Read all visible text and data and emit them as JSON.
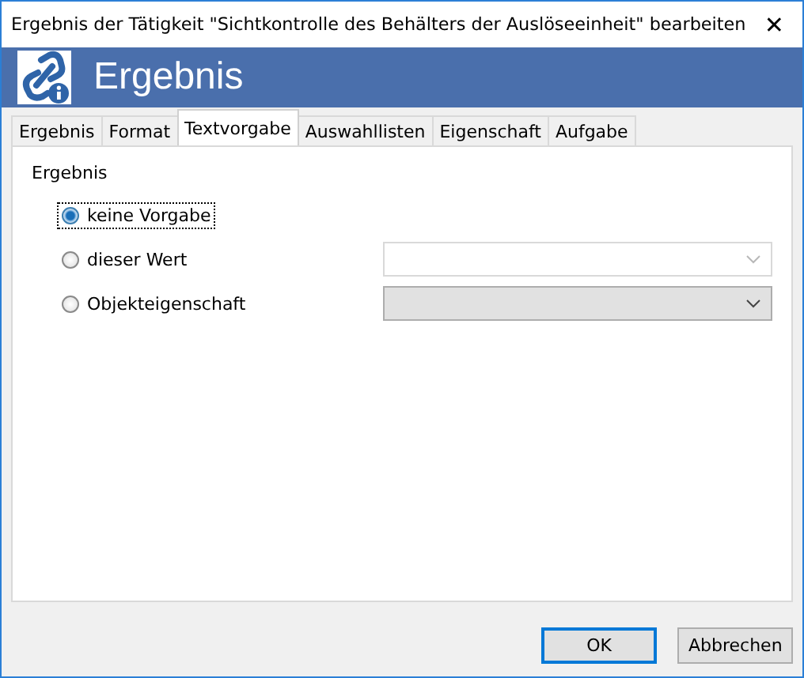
{
  "window": {
    "title": "Ergebnis der Tätigkeit \"Sichtkontrolle des Behälters der Auslöseeinheit\" bearbeiten",
    "close": "✕"
  },
  "banner": {
    "title": "Ergebnis"
  },
  "tabs": [
    {
      "label": "Ergebnis",
      "selected": false
    },
    {
      "label": "Format",
      "selected": false
    },
    {
      "label": "Textvorgabe",
      "selected": true
    },
    {
      "label": "Auswahllisten",
      "selected": false
    },
    {
      "label": "Eigenschaft",
      "selected": false
    },
    {
      "label": "Aufgabe",
      "selected": false
    }
  ],
  "group": {
    "label": "Ergebnis"
  },
  "options": [
    {
      "label": "keine Vorgabe",
      "selected": true,
      "focused": true
    },
    {
      "label": "dieser Wert",
      "selected": false,
      "focused": false,
      "dropdown": {
        "disabled": true
      }
    },
    {
      "label": "Objekteigenschaft",
      "selected": false,
      "focused": false,
      "dropdown": {
        "disabled": false
      }
    }
  ],
  "buttons": [
    {
      "label": "OK",
      "default": true
    },
    {
      "label": "Abbrechen",
      "default": false
    }
  ]
}
